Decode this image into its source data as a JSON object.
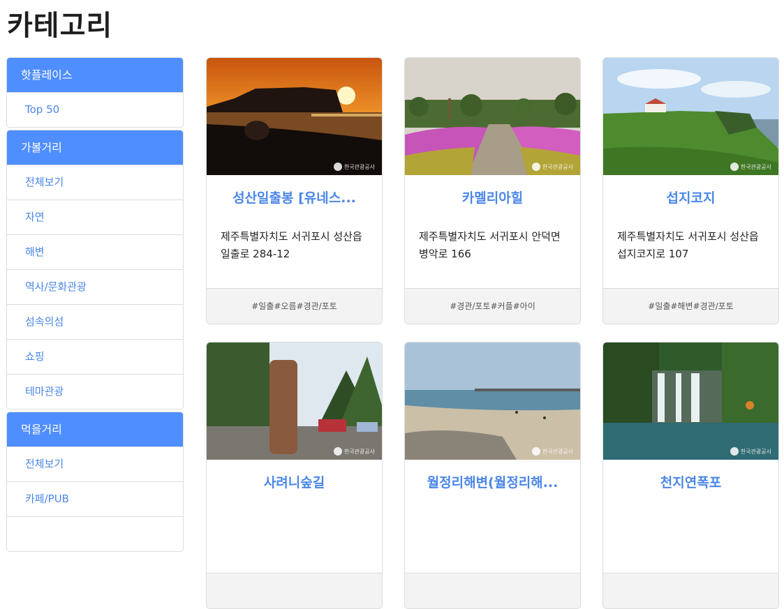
{
  "page": {
    "title": "카테고리"
  },
  "sidebar": {
    "groups": [
      {
        "header": "핫플레이스",
        "items": [
          "Top 50"
        ]
      },
      {
        "header": "가볼거리",
        "items": [
          "전체보기",
          "자연",
          "해변",
          "역사/문화관광",
          "섬속의섬",
          "쇼핑",
          "테마관광"
        ]
      },
      {
        "header": "먹을거리",
        "items": [
          "전체보기",
          "카페/PUB"
        ]
      }
    ]
  },
  "cards": [
    {
      "title": "성산일출봉 [유네스...",
      "address": "제주특별자치도 서귀포시 성산읍 일출로 284-12",
      "tags": "#일출#오름#경관/포토",
      "watermark": "한국관광공사"
    },
    {
      "title": "카멜리아힐",
      "address": "제주특별자치도 서귀포시 안덕면 병악로 166",
      "tags": "#경관/포토#커플#아이",
      "watermark": "한국관광공사"
    },
    {
      "title": "섭지코지",
      "address": "제주특별자치도 서귀포시 성산읍 섭지코지로 107",
      "tags": "#일출#해변#경관/포토",
      "watermark": "한국관광공사"
    },
    {
      "title": "사려니숲길",
      "address": "",
      "tags": "",
      "watermark": "한국관광공사"
    },
    {
      "title": "월정리해변(월정리해...",
      "address": "",
      "tags": "",
      "watermark": "한국관광공사"
    },
    {
      "title": "천지연폭포",
      "address": "",
      "tags": "",
      "watermark": "한국관광공사"
    }
  ]
}
